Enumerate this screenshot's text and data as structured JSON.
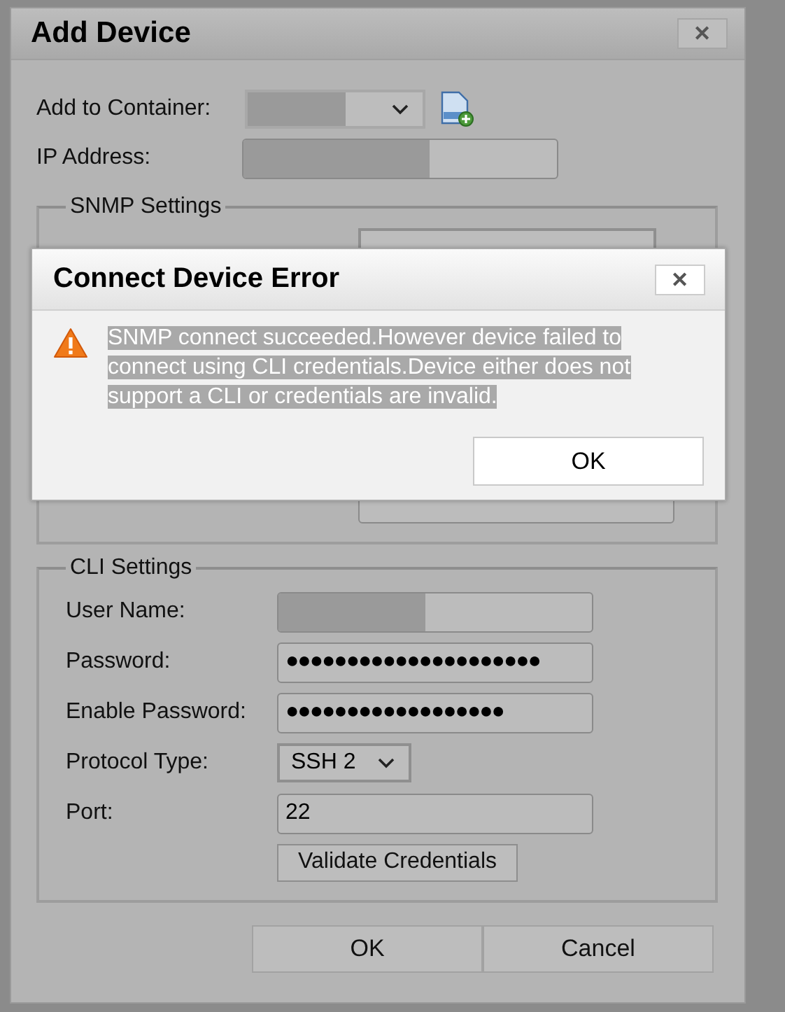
{
  "dialog": {
    "title": "Add Device",
    "close_label": "✕"
  },
  "container": {
    "label": "Add to Container:"
  },
  "ip": {
    "label": "IP Address:"
  },
  "snmp": {
    "legend": "SNMP Settings"
  },
  "cli": {
    "legend": "CLI Settings",
    "rows": [
      {
        "kind": "text",
        "label": "User Name:",
        "value": "",
        "redacted": true
      },
      {
        "kind": "text",
        "label": "Password:",
        "value": "●●●●●●●●●●●●●●●●●●●●●"
      },
      {
        "kind": "text",
        "label": "Enable Password:",
        "value": "●●●●●●●●●●●●●●●●●●"
      },
      {
        "kind": "select",
        "label": "Protocol Type:",
        "value": "SSH 2"
      },
      {
        "kind": "text",
        "label": "Port:",
        "value": "22"
      }
    ],
    "validate": "Validate Credentials"
  },
  "buttons": [
    "OK",
    "Cancel"
  ],
  "error": {
    "title": "Connect Device Error",
    "close_label": "✕",
    "message": "SNMP connect succeeded.However device failed to connect using CLI credentials.Device either does not support a CLI or credentials are invalid.",
    "selected": true,
    "button": "OK"
  }
}
